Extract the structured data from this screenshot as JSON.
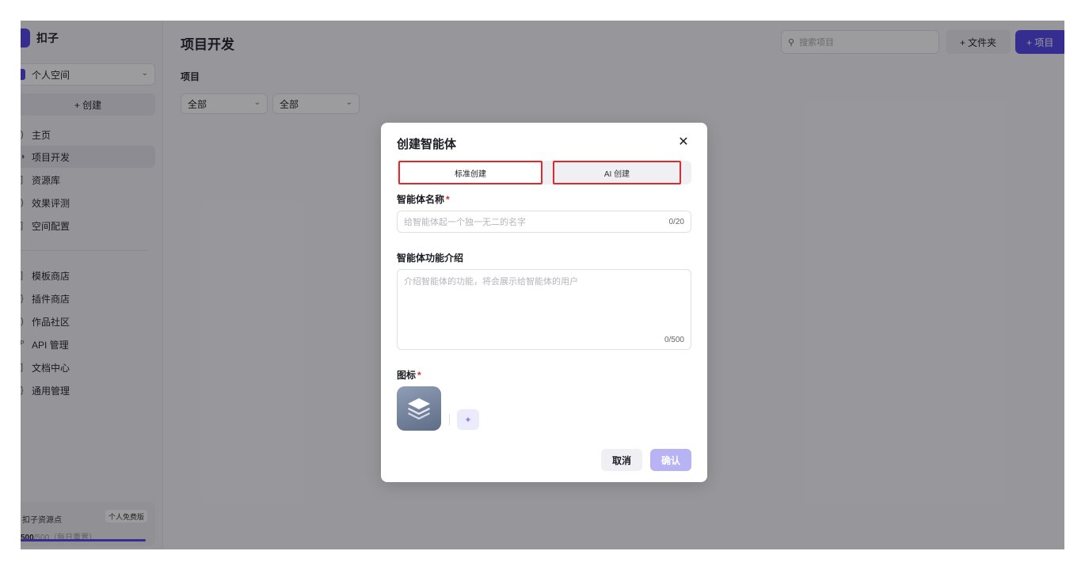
{
  "app": {
    "name": "扣子"
  },
  "sidebar": {
    "space_select": "个人空间",
    "create_label": "+  创建",
    "nav_main": [
      {
        "label": "主页",
        "icon": "home-icon",
        "active": false
      },
      {
        "label": "项目开发",
        "icon": "project-icon",
        "active": true
      },
      {
        "label": "资源库",
        "icon": "library-icon",
        "active": false
      },
      {
        "label": "效果评测",
        "icon": "evaluation-icon",
        "active": false
      },
      {
        "label": "空间配置",
        "icon": "settings-icon",
        "active": false
      }
    ],
    "nav_secondary": [
      {
        "label": "模板商店",
        "icon": "template-icon"
      },
      {
        "label": "插件商店",
        "icon": "plugin-icon"
      },
      {
        "label": "作品社区",
        "icon": "community-icon"
      },
      {
        "label": "API 管理",
        "icon": "api-icon"
      },
      {
        "label": "文档中心",
        "icon": "docs-icon"
      },
      {
        "label": "通用管理",
        "icon": "admin-icon"
      }
    ],
    "resource": {
      "title": "扣子资源点",
      "plan_badge": "个人免费版",
      "value": "500",
      "total": "/500（每日重置）"
    }
  },
  "main": {
    "title": "项目开发",
    "search_placeholder": "搜索项目",
    "folder_button": "+  文件夹",
    "project_button": "+  项目",
    "section_label": "项目",
    "filters": [
      "全部",
      "全部"
    ]
  },
  "modal": {
    "title": "创建智能体",
    "tabs": {
      "standard": "标准创建",
      "ai": "AI 创建"
    },
    "name_label": "智能体名称",
    "name_placeholder": "给智能体起一个独一无二的名字",
    "name_counter": "0/20",
    "desc_label": "智能体功能介绍",
    "desc_placeholder": "介绍智能体的功能，将会展示给智能体的用户",
    "desc_counter": "0/500",
    "icon_label": "图标",
    "required_mark": "*",
    "cancel": "取消",
    "confirm": "确认"
  },
  "colors": {
    "accent": "#4e40e5",
    "highlight": "#e02a2a"
  }
}
